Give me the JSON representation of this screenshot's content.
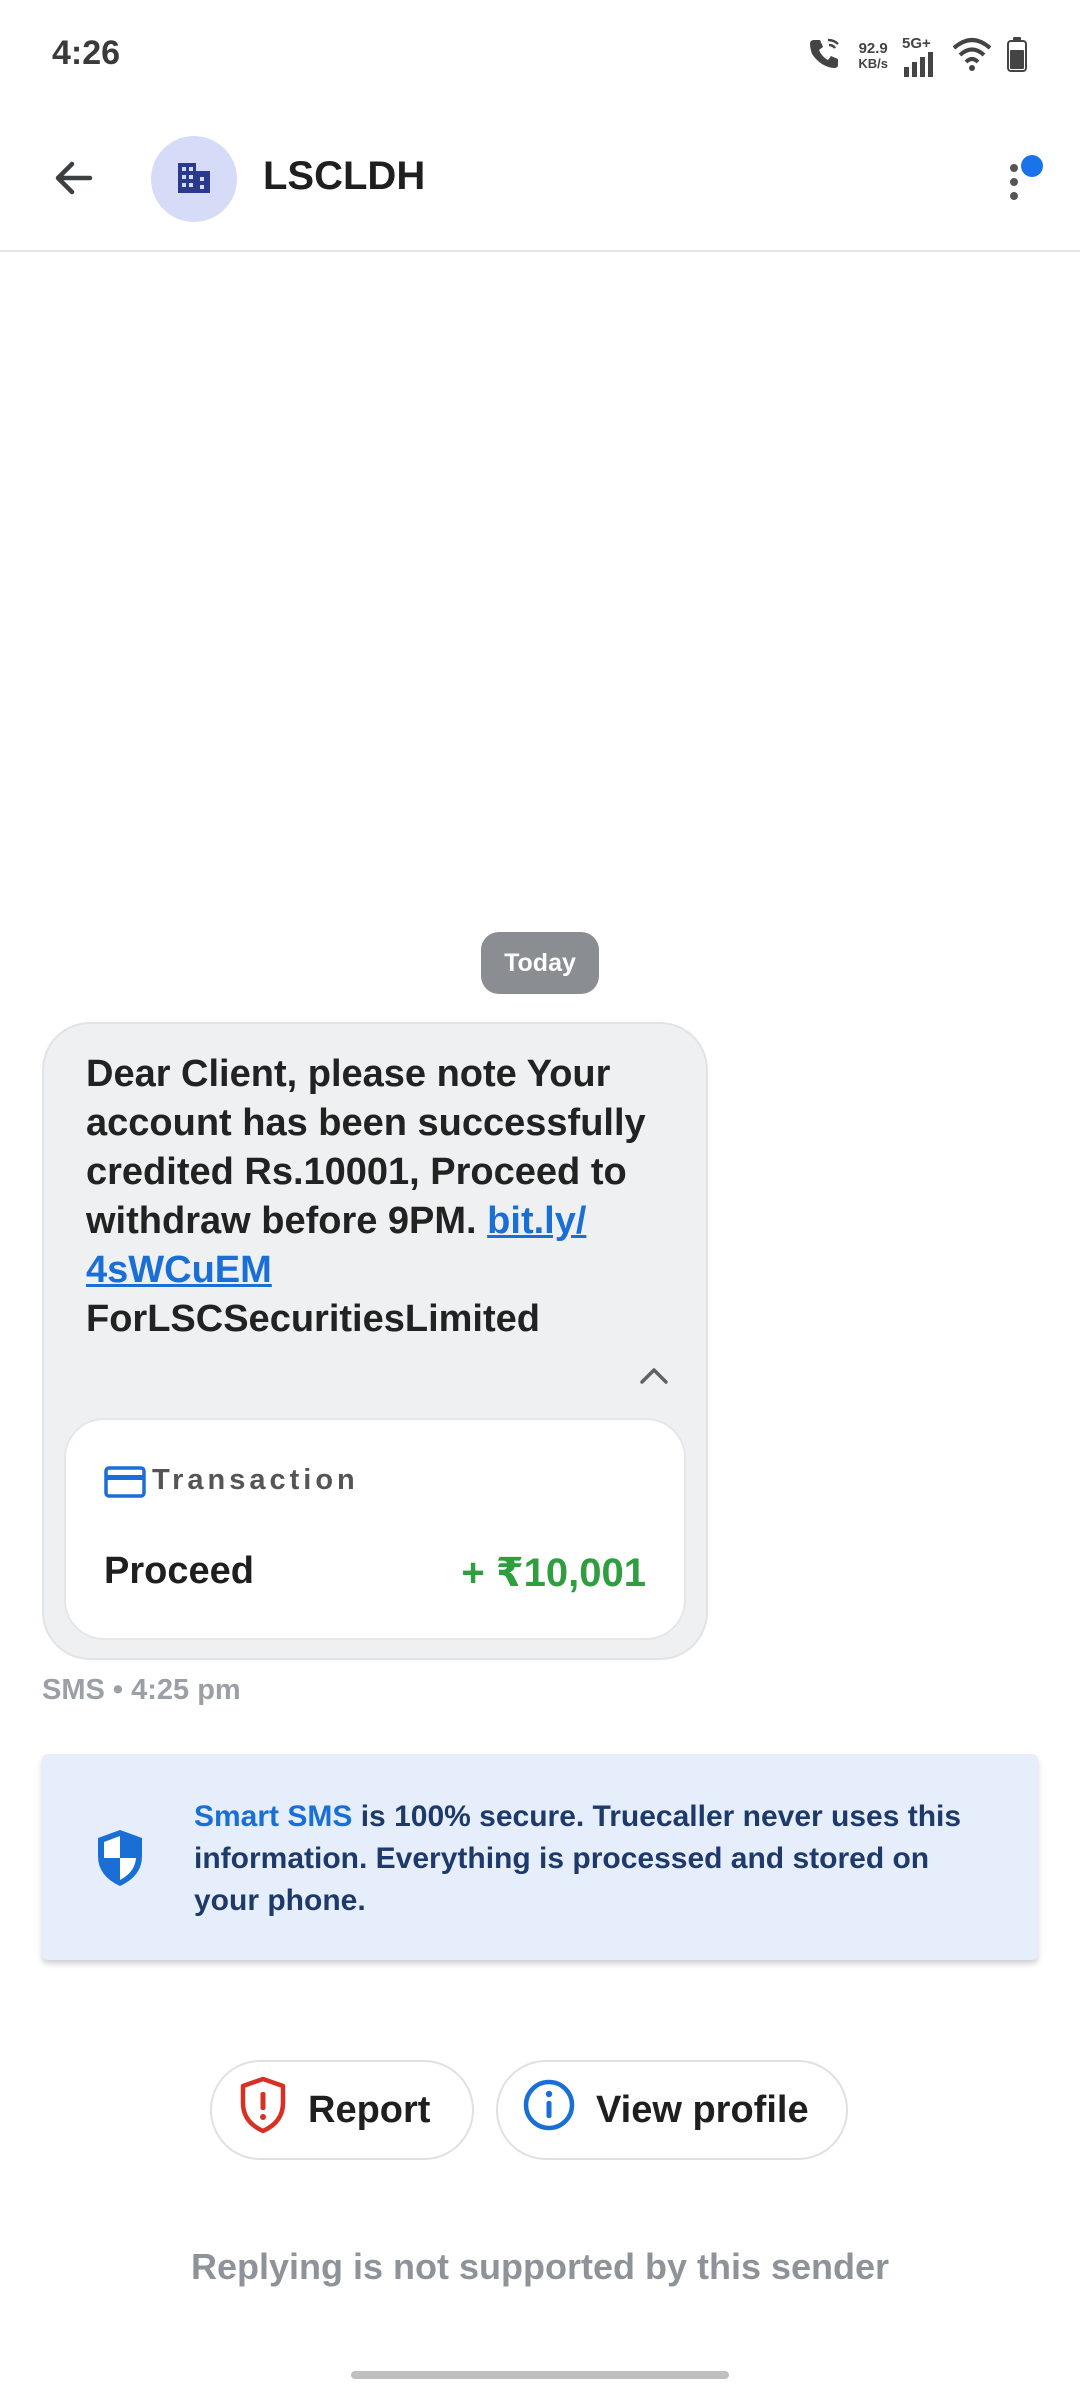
{
  "status_bar": {
    "time": "4:26",
    "net_speed_value": "92.9",
    "net_speed_unit": "KB/s",
    "network_type": "5G+",
    "icons": [
      "wifi-calling-icon",
      "signal-icon",
      "wifi-icon",
      "battery-icon"
    ]
  },
  "header": {
    "sender_name": "LSCLDH",
    "avatar_icon": "building-icon",
    "back_icon": "arrow-back-icon",
    "menu_icon": "more-vert-icon",
    "badge_color": "#1a73e8"
  },
  "conversation": {
    "date_chip": "Today",
    "message": {
      "text_before_link": "Dear Client, please note Your account has been successfully credited Rs.10001, Proceed to withdraw before 9PM. ",
      "link_line1": "bit.ly/",
      "link_line2": "4sWCuEM",
      "signature": "ForLSCSecuritiesLimited",
      "meta": "SMS • 4:25 pm"
    },
    "transaction_card": {
      "label": "Transaction",
      "title": "Proceed",
      "amount": "+ ₹10,001",
      "amount_color": "#2e9e3e"
    }
  },
  "smart_sms": {
    "brand": "Smart SMS",
    "text": " is 100% secure. Truecaller never uses this information. Everything is processed and stored on your phone."
  },
  "actions": {
    "report_label": "Report",
    "view_profile_label": "View profile"
  },
  "footer": {
    "reply_note": "Replying is not supported by this sender"
  }
}
